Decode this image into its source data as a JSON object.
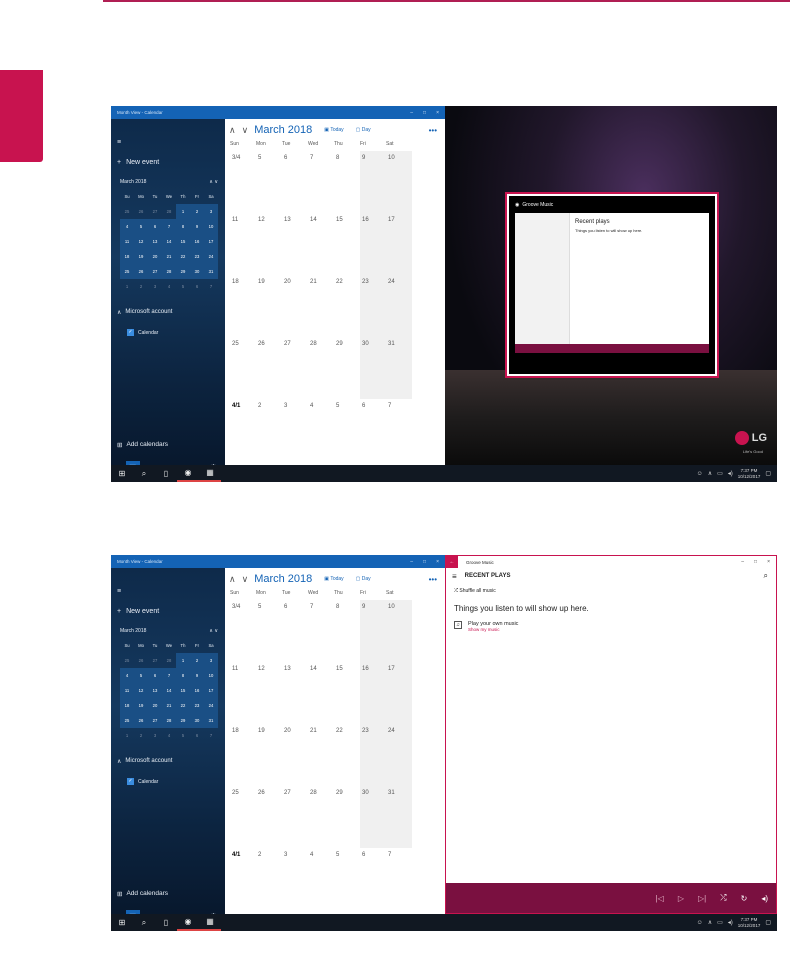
{
  "calendar": {
    "window_title": "Month View - Calendar",
    "new_event": "New event",
    "mini_month": "March 2018",
    "weekday_short": [
      "Su",
      "Mo",
      "Tu",
      "We",
      "Th",
      "Fr",
      "Sa"
    ],
    "mini_days": [
      [
        "25",
        "26",
        "27",
        "28",
        "1",
        "2",
        "3"
      ],
      [
        "4",
        "5",
        "6",
        "7",
        "8",
        "9",
        "10"
      ],
      [
        "11",
        "12",
        "13",
        "14",
        "15",
        "16",
        "17"
      ],
      [
        "18",
        "19",
        "20",
        "21",
        "22",
        "23",
        "24"
      ],
      [
        "25",
        "26",
        "27",
        "28",
        "29",
        "30",
        "31"
      ],
      [
        "1",
        "2",
        "3",
        "4",
        "5",
        "6",
        "7"
      ]
    ],
    "account_label": "Microsoft account",
    "calendar_label": "Calendar",
    "add_calendars": "Add calendars",
    "month_title": "March 2018",
    "today_label": "Today",
    "day_label": "Day",
    "more_label": "•••",
    "weekdays": [
      "Sun",
      "Mon",
      "Tue",
      "Wed",
      "Thu",
      "Fri",
      "Sat"
    ],
    "weeks": [
      [
        "3/4",
        "5",
        "6",
        "7",
        "8",
        "9",
        "10"
      ],
      [
        "11",
        "12",
        "13",
        "14",
        "15",
        "16",
        "17"
      ],
      [
        "18",
        "19",
        "20",
        "21",
        "22",
        "23",
        "24"
      ],
      [
        "25",
        "26",
        "27",
        "28",
        "29",
        "30",
        "31"
      ],
      [
        "4/1",
        "2",
        "3",
        "4",
        "5",
        "6",
        "7"
      ]
    ]
  },
  "groove": {
    "title": "Groove Music",
    "header": "RECENT PLAYS",
    "shuffle": "Shuffle all music",
    "empty": "Things you listen to will show up here.",
    "own_music": "Play your own music",
    "show_music": "Show my music",
    "recent_plays": "Recent plays"
  },
  "desktop": {
    "brand": "LG",
    "tagline": "Life's Good"
  },
  "taskbar": {
    "time": "7:37 PM",
    "date": "10/12/2017"
  },
  "controls": {
    "minimize": "–",
    "maximize": "□",
    "close": "×"
  },
  "colors": {
    "accent_calendar": "#1463b5",
    "accent_groove": "#c8134f",
    "player_bar": "#7a1040"
  }
}
